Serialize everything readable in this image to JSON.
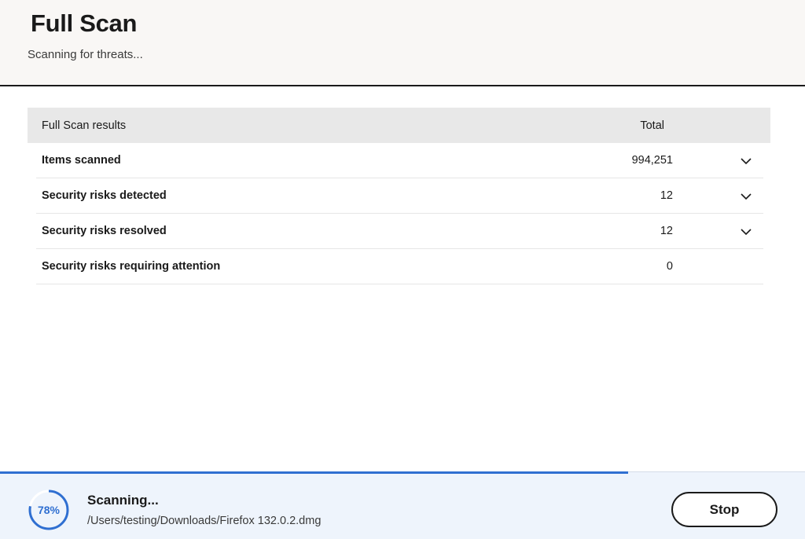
{
  "header": {
    "title": "Full Scan",
    "subtitle": "Scanning for threats..."
  },
  "results": {
    "columns": {
      "name": "Full Scan results",
      "total": "Total"
    },
    "rows": [
      {
        "label": "Items scanned",
        "value": "994,251",
        "expandable": true,
        "icon": "chevron-down-icon"
      },
      {
        "label": "Security risks detected",
        "value": "12",
        "expandable": true,
        "icon": "chevron-down-icon"
      },
      {
        "label": "Security risks resolved",
        "value": "12",
        "expandable": true,
        "icon": "chevron-down-icon"
      },
      {
        "label": "Security risks requiring attention",
        "value": "0",
        "expandable": false
      }
    ]
  },
  "footer": {
    "progress_percent": 78,
    "progress_label": "78%",
    "status": "Scanning...",
    "current_file": "/Users/testing/Downloads/Firefox 132.0.2.dmg",
    "stop_label": "Stop"
  },
  "colors": {
    "accent": "#2f6fd1",
    "header_bg": "#f9f7f5",
    "footer_bg": "#eef4fc",
    "table_head_bg": "#e8e8e8"
  }
}
